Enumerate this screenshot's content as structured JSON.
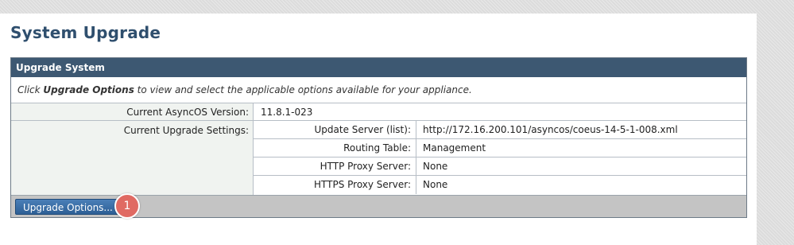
{
  "page": {
    "title": "System Upgrade"
  },
  "box": {
    "header": "Upgrade System",
    "intro_prefix": "Click ",
    "intro_bold": "Upgrade Options",
    "intro_suffix": " to view and select the applicable options available for your appliance."
  },
  "version": {
    "label": "Current AsyncOS Version:",
    "value": "11.8.1-023"
  },
  "settings": {
    "label": "Current Upgrade Settings:",
    "rows": [
      {
        "label": "Update Server (list):",
        "value": "http://172.16.200.101/asyncos/coeus-14-5-1-008.xml"
      },
      {
        "label": "Routing Table:",
        "value": "Management"
      },
      {
        "label": "HTTP Proxy Server:",
        "value": "None"
      },
      {
        "label": "HTTPS Proxy Server:",
        "value": "None"
      }
    ]
  },
  "footer": {
    "button_label": "Upgrade Options...",
    "callout_number": "1"
  },
  "colors": {
    "header_bg": "#3d5872",
    "title": "#2f4f6e",
    "button": "#2d5f95",
    "callout": "#e06a63"
  }
}
